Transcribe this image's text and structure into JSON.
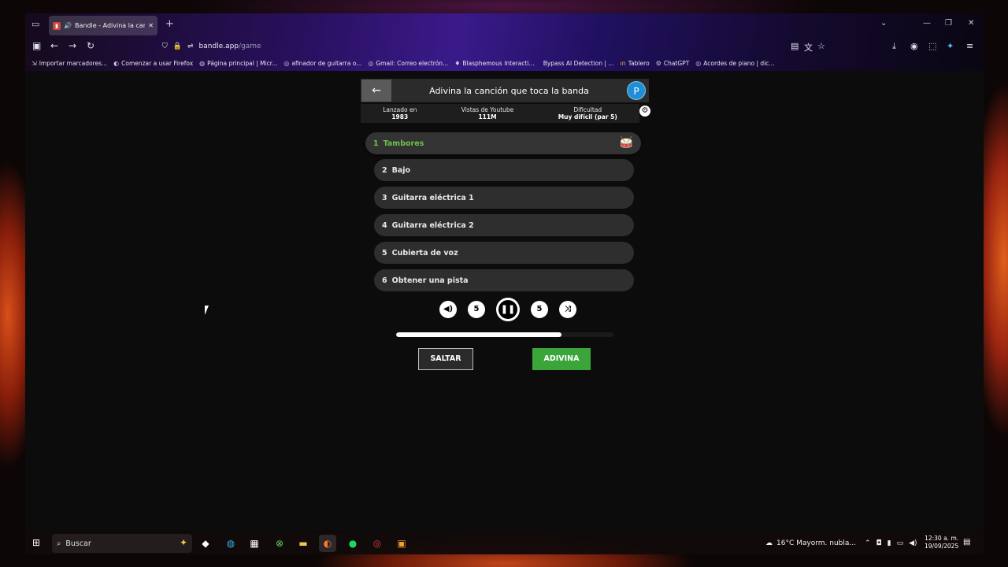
{
  "browser": {
    "tab_title": "Bandle - Adivina la canción",
    "url_host": "bandle.app",
    "url_path": "/game",
    "bookmarks": [
      "Importar marcadores...",
      "Comenzar a usar Firefox",
      "Página principal | Micr...",
      "afinador de guitarra o...",
      "Gmail: Correo electrón...",
      "Blasphemous Interacti...",
      "Bypass AI Detection | ...",
      "Tablero",
      "ChatGPT",
      "Acordes de piano | dic..."
    ]
  },
  "game": {
    "header_title": "Adivina la canción que toca la banda",
    "avatar_letter": "P",
    "stats": {
      "released_label": "Lanzado en",
      "released_value": "1983",
      "views_label": "Vistas de Youtube",
      "views_value": "111M",
      "difficulty_label": "Dificultad",
      "difficulty_value": "Muy difícil (par 5)"
    },
    "tracks": [
      {
        "number": "1",
        "label": "Tambores"
      },
      {
        "number": "2",
        "label": "Bajo"
      },
      {
        "number": "3",
        "label": "Guitarra eléctrica 1"
      },
      {
        "number": "4",
        "label": "Guitarra eléctrica 2"
      },
      {
        "number": "5",
        "label": "Cubierta de voz"
      },
      {
        "number": "6",
        "label": "Obtener una pista"
      }
    ],
    "controls": {
      "rewind_seconds": "5",
      "forward_seconds": "5"
    },
    "progress_fraction": 0.76,
    "skip_label": "SALTAR",
    "guess_label": "ADIVINA"
  },
  "taskbar": {
    "search_placeholder": "Buscar",
    "weather": "16°C  Mayorm. nubla...",
    "time": "12:30 a. m.",
    "date": "19/09/2025"
  },
  "colors": {
    "accent_green": "#3ca53a",
    "active_track_text": "#6cc04a",
    "avatar_blue": "#1f8ed6"
  }
}
